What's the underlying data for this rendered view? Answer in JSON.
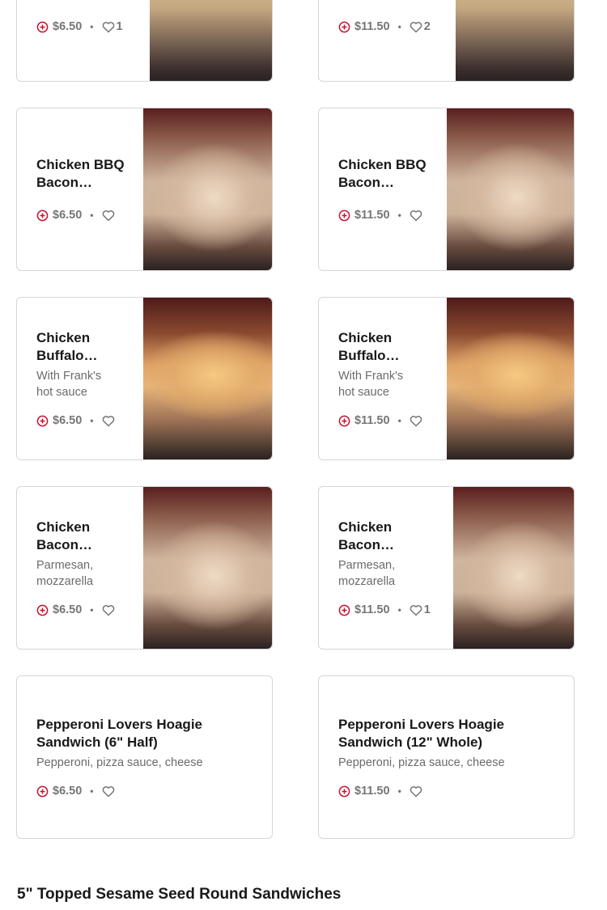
{
  "cards": [
    {
      "id": "c0",
      "title": "",
      "description": "",
      "price": "$6.50",
      "likes": "1"
    },
    {
      "id": "c1",
      "title": "",
      "description": "",
      "price": "$11.50",
      "likes": "2"
    },
    {
      "id": "c2",
      "title": "Chicken BBQ Bacon…",
      "description": "",
      "price": "$6.50",
      "likes": ""
    },
    {
      "id": "c3",
      "title": "Chicken BBQ Bacon…",
      "description": "",
      "price": "$11.50",
      "likes": ""
    },
    {
      "id": "c4",
      "title": "Chicken Buffalo…",
      "description": "With Frank's hot sauce",
      "price": "$6.50",
      "likes": ""
    },
    {
      "id": "c5",
      "title": "Chicken Buffalo…",
      "description": "With Frank's hot sauce",
      "price": "$11.50",
      "likes": ""
    },
    {
      "id": "c6",
      "title": "Chicken Bacon…",
      "description": "Parmesan, mozzarella",
      "price": "$6.50",
      "likes": ""
    },
    {
      "id": "c7",
      "title": "Chicken Bacon…",
      "description": "Parmesan, mozzarella",
      "price": "$11.50",
      "likes": "1"
    },
    {
      "id": "c8",
      "title": "Pepperoni Lovers Hoagie Sandwich (6\" Half)",
      "description": "Pepperoni, pizza sauce, cheese",
      "price": "$6.50",
      "likes": ""
    },
    {
      "id": "c9",
      "title": "Pepperoni Lovers Hoagie Sandwich (12\" Whole)",
      "description": "Pepperoni, pizza sauce, cheese",
      "price": "$11.50",
      "likes": ""
    }
  ],
  "meta_separator": "•",
  "section_title": "5\" Topped Sesame Seed Round Sandwiches",
  "icons": {
    "add": "add-circle-icon",
    "like": "heart-outline-icon"
  },
  "colors": {
    "accent": "#eb1700",
    "text": "#191919",
    "muted": "#767676",
    "border": "#d6d6d6"
  }
}
